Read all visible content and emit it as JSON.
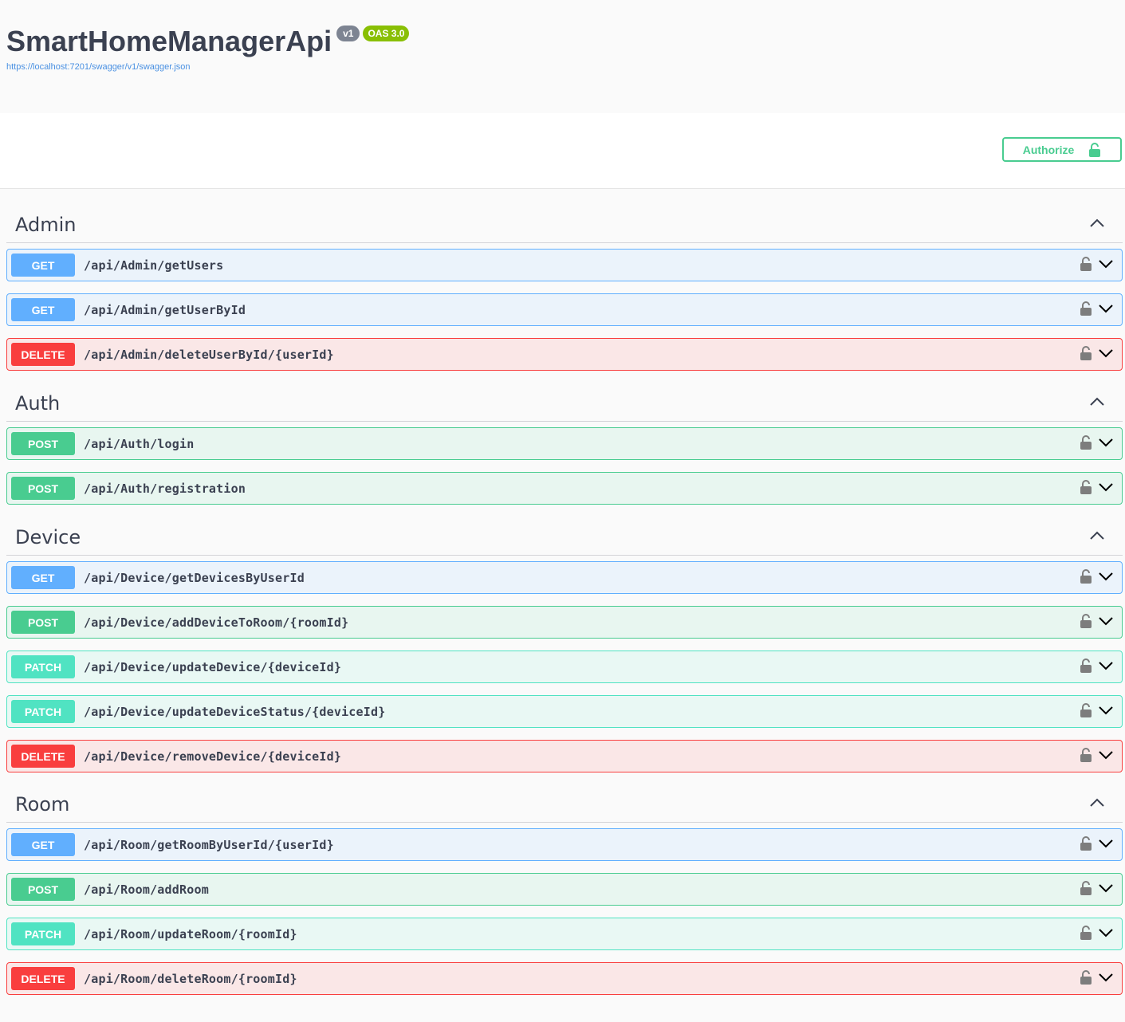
{
  "header": {
    "title": "SmartHomeManagerApi",
    "version": "v1",
    "oas": "OAS 3.0",
    "spec_url": "https://localhost:7201/swagger/v1/swagger.json"
  },
  "authorize": {
    "label": "Authorize"
  },
  "tags": [
    {
      "name": "Admin",
      "operations": [
        {
          "method": "GET",
          "path": "/api/Admin/getUsers"
        },
        {
          "method": "GET",
          "path": "/api/Admin/getUserById"
        },
        {
          "method": "DELETE",
          "path": "/api/Admin/deleteUserById/{userId}"
        }
      ]
    },
    {
      "name": "Auth",
      "operations": [
        {
          "method": "POST",
          "path": "/api/Auth/login"
        },
        {
          "method": "POST",
          "path": "/api/Auth/registration"
        }
      ]
    },
    {
      "name": "Device",
      "operations": [
        {
          "method": "GET",
          "path": "/api/Device/getDevicesByUserId"
        },
        {
          "method": "POST",
          "path": "/api/Device/addDeviceToRoom/{roomId}"
        },
        {
          "method": "PATCH",
          "path": "/api/Device/updateDevice/{deviceId}"
        },
        {
          "method": "PATCH",
          "path": "/api/Device/updateDeviceStatus/{deviceId}"
        },
        {
          "method": "DELETE",
          "path": "/api/Device/removeDevice/{deviceId}"
        }
      ]
    },
    {
      "name": "Room",
      "operations": [
        {
          "method": "GET",
          "path": "/api/Room/getRoomByUserId/{userId}"
        },
        {
          "method": "POST",
          "path": "/api/Room/addRoom"
        },
        {
          "method": "PATCH",
          "path": "/api/Room/updateRoom/{roomId}"
        },
        {
          "method": "DELETE",
          "path": "/api/Room/deleteRoom/{roomId}"
        }
      ]
    }
  ],
  "colors": {
    "get": "#61affe",
    "post": "#49cc90",
    "patch": "#50e3c2",
    "delete": "#f93e3e",
    "authorize": "#49cc90"
  }
}
